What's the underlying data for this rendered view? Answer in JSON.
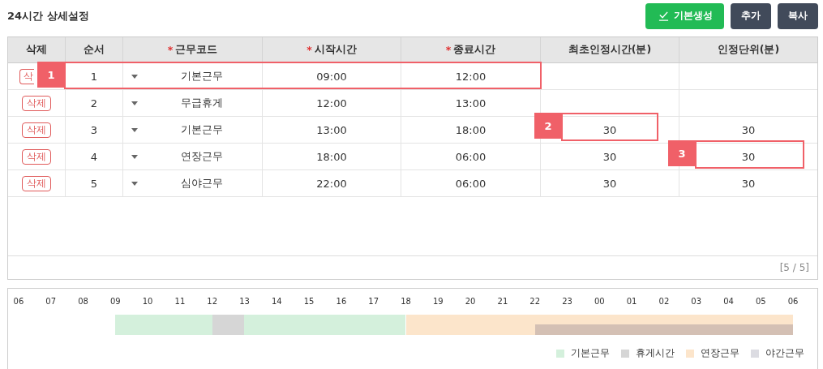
{
  "title": "24시간 상세설정",
  "buttons": [
    {
      "label": "기본생성",
      "kind": "primary"
    },
    {
      "label": "추가",
      "kind": "dark"
    },
    {
      "label": "복사",
      "kind": "dark"
    }
  ],
  "table": {
    "columns": [
      {
        "label": "삭제"
      },
      {
        "label": "순서"
      },
      {
        "label": "근무코드",
        "mark": "*"
      },
      {
        "label": "시작시간",
        "mark": "*"
      },
      {
        "label": "종료시간",
        "mark": "*"
      },
      {
        "label": "최초인정시간(분)"
      },
      {
        "label": "인정단위(분)"
      }
    ],
    "rows": [
      {
        "delete": "삭",
        "order": "1",
        "code": "기본근무",
        "start": "09:00",
        "end": "12:00"
      },
      {
        "delete": "삭제",
        "order": "2",
        "code": "무급휴게",
        "start": "12:00",
        "end": "13:00"
      },
      {
        "delete": "삭제",
        "order": "3",
        "code": "기본근무",
        "start": "13:00",
        "end": "18:00",
        "first": "30",
        "unit": "30"
      },
      {
        "delete": "삭제",
        "order": "4",
        "code": "연장근무",
        "start": "18:00",
        "end": "06:00",
        "first": "30",
        "unit": "30"
      },
      {
        "delete": "삭제",
        "order": "5",
        "code": "심야근무",
        "start": "22:00",
        "end": "06:00",
        "first": "30",
        "unit": "30"
      }
    ],
    "pager": "[5 / 5]"
  },
  "callouts": [
    {
      "label": "1"
    },
    {
      "label": "2"
    },
    {
      "label": "3"
    }
  ],
  "timeline": {
    "hours": [
      "06",
      "07",
      "08",
      "09",
      "10",
      "11",
      "12",
      "13",
      "14",
      "15",
      "16",
      "17",
      "18",
      "19",
      "20",
      "21",
      "22",
      "23",
      "00",
      "01",
      "02",
      "03",
      "04",
      "05",
      "06"
    ],
    "legend": [
      {
        "label": "기본근무",
        "color": "#d4f0dc"
      },
      {
        "label": "휴게시간",
        "color": "#d6d6d6"
      },
      {
        "label": "연장근무",
        "color": "#fce5cb"
      },
      {
        "label": "야간근무",
        "color": "#dcdce2"
      }
    ]
  }
}
